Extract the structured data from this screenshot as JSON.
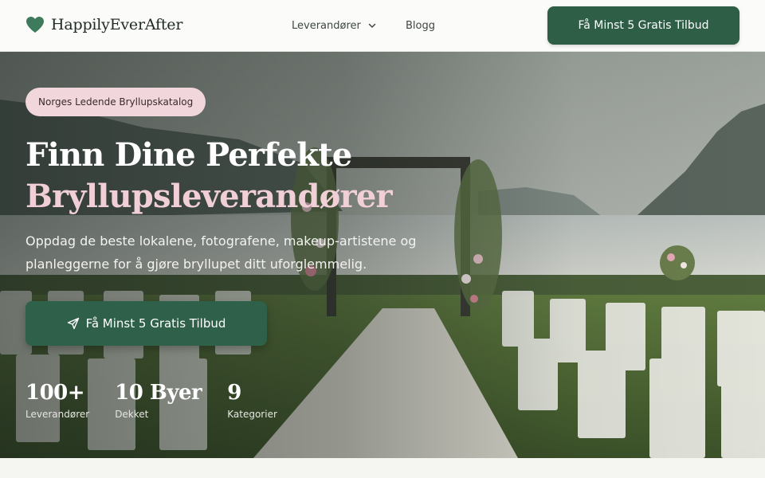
{
  "header": {
    "brand": "HappilyEverAfter",
    "nav": {
      "vendors_label": "Leverandører",
      "blog_label": "Blogg"
    },
    "cta_label": "Få Minst 5 Gratis Tilbud"
  },
  "hero": {
    "badge": "Norges Ledende Bryllupskatalog",
    "title_line1": "Finn Dine Perfekte",
    "title_line2": "Bryllupsleverandører",
    "subtitle": "Oppdag de beste lokalene, fotografene, makeup-artistene og planleggerne for å gjøre bryllupet ditt uforglemmelig.",
    "cta_label": "Få Minst 5 Gratis Tilbud",
    "stats": [
      {
        "value": "100+",
        "label": "Leverandører"
      },
      {
        "value": "10 Byer",
        "label": "Dekket"
      },
      {
        "value": "9",
        "label": "Kategorier"
      }
    ]
  },
  "icons": {
    "logo": "heart-icon",
    "nav_dropdown": "chevron-down-icon",
    "cta": "send-icon"
  },
  "colors": {
    "brand_green": "#2f5e47",
    "accent_pink": "#f1d6dc",
    "title_pink": "#f0cfd6"
  }
}
